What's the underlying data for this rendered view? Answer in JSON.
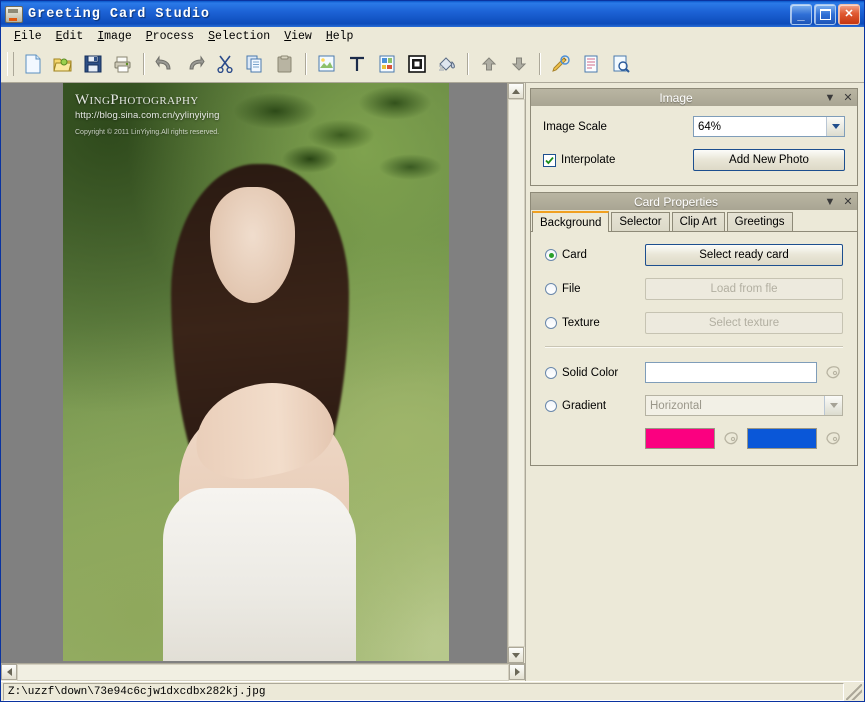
{
  "window": {
    "title": "Greeting Card Studio",
    "icon": "printer-icon",
    "buttons": {
      "minimize": "_",
      "maximize": "□",
      "close": "✕"
    }
  },
  "menubar": {
    "items": [
      {
        "label": "File",
        "accel": "F"
      },
      {
        "label": "Edit",
        "accel": "E"
      },
      {
        "label": "Image",
        "accel": "I"
      },
      {
        "label": "Process",
        "accel": "P"
      },
      {
        "label": "Selection",
        "accel": "S"
      },
      {
        "label": "View",
        "accel": "V"
      },
      {
        "label": "Help",
        "accel": "H"
      }
    ]
  },
  "toolbar": {
    "groups": [
      {
        "items": [
          {
            "name": "new-document-icon",
            "tip": "New"
          },
          {
            "name": "open-folder-icon",
            "tip": "Open"
          },
          {
            "name": "save-disk-icon",
            "tip": "Save"
          },
          {
            "name": "print-icon",
            "tip": "Print"
          }
        ]
      },
      {
        "items": [
          {
            "name": "undo-icon",
            "tip": "Undo"
          },
          {
            "name": "redo-icon",
            "tip": "Redo"
          },
          {
            "name": "cut-scissors-icon",
            "tip": "Cut"
          },
          {
            "name": "copy-icon",
            "tip": "Copy"
          },
          {
            "name": "paste-icon",
            "tip": "Paste"
          }
        ]
      },
      {
        "items": [
          {
            "name": "insert-image-icon",
            "tip": "Insert Image"
          },
          {
            "name": "insert-text-icon",
            "tip": "Insert Text"
          },
          {
            "name": "clip-art-icon",
            "tip": "Clip Art"
          },
          {
            "name": "frame-icon",
            "tip": "Frame"
          },
          {
            "name": "paint-bucket-icon",
            "tip": "Paint"
          }
        ]
      },
      {
        "items": [
          {
            "name": "move-up-icon",
            "tip": "Move Up"
          },
          {
            "name": "move-down-icon",
            "tip": "Move Down"
          }
        ]
      },
      {
        "items": [
          {
            "name": "edit-pen-icon",
            "tip": "Edit"
          },
          {
            "name": "page-setup-icon",
            "tip": "Page Setup"
          },
          {
            "name": "print-preview-icon",
            "tip": "Print Preview"
          }
        ]
      }
    ]
  },
  "canvas": {
    "watermark": {
      "title": "WingPhotography",
      "url": "http://blog.sina.com.cn/yylinyiying",
      "copyright": "Copyright © 2011 LinYiying.All rights reserved."
    },
    "background_color": "#808080"
  },
  "image_panel": {
    "title": "Image",
    "scale_label": "Image Scale",
    "scale_value": "64%",
    "interpolate_label": "Interpolate",
    "interpolate_checked": true,
    "add_photo_label": "Add New Photo"
  },
  "card_panel": {
    "title": "Card Properties",
    "tabs": [
      {
        "label": "Background",
        "active": true
      },
      {
        "label": "Selector",
        "active": false
      },
      {
        "label": "Clip Art",
        "active": false
      },
      {
        "label": "Greetings",
        "active": false
      }
    ],
    "options": [
      {
        "label": "Card",
        "selected": true,
        "button": "Select ready card",
        "disabled": false
      },
      {
        "label": "File",
        "selected": false,
        "button": "Load from fle",
        "disabled": true
      },
      {
        "label": "Texture",
        "selected": false,
        "button": "Select texture",
        "disabled": true
      }
    ],
    "solid_color": {
      "label": "Solid Color",
      "selected": false,
      "value": "#ffffff"
    },
    "gradient": {
      "label": "Gradient",
      "selected": false,
      "direction": "Horizontal",
      "color_start": "#fb0080",
      "color_end": "#0a57d8"
    },
    "accent_color": "#f0a020"
  },
  "statusbar": {
    "path": "Z:\\uzzf\\down\\73e94c6cjw1dxcdbx282kj.jpg"
  }
}
